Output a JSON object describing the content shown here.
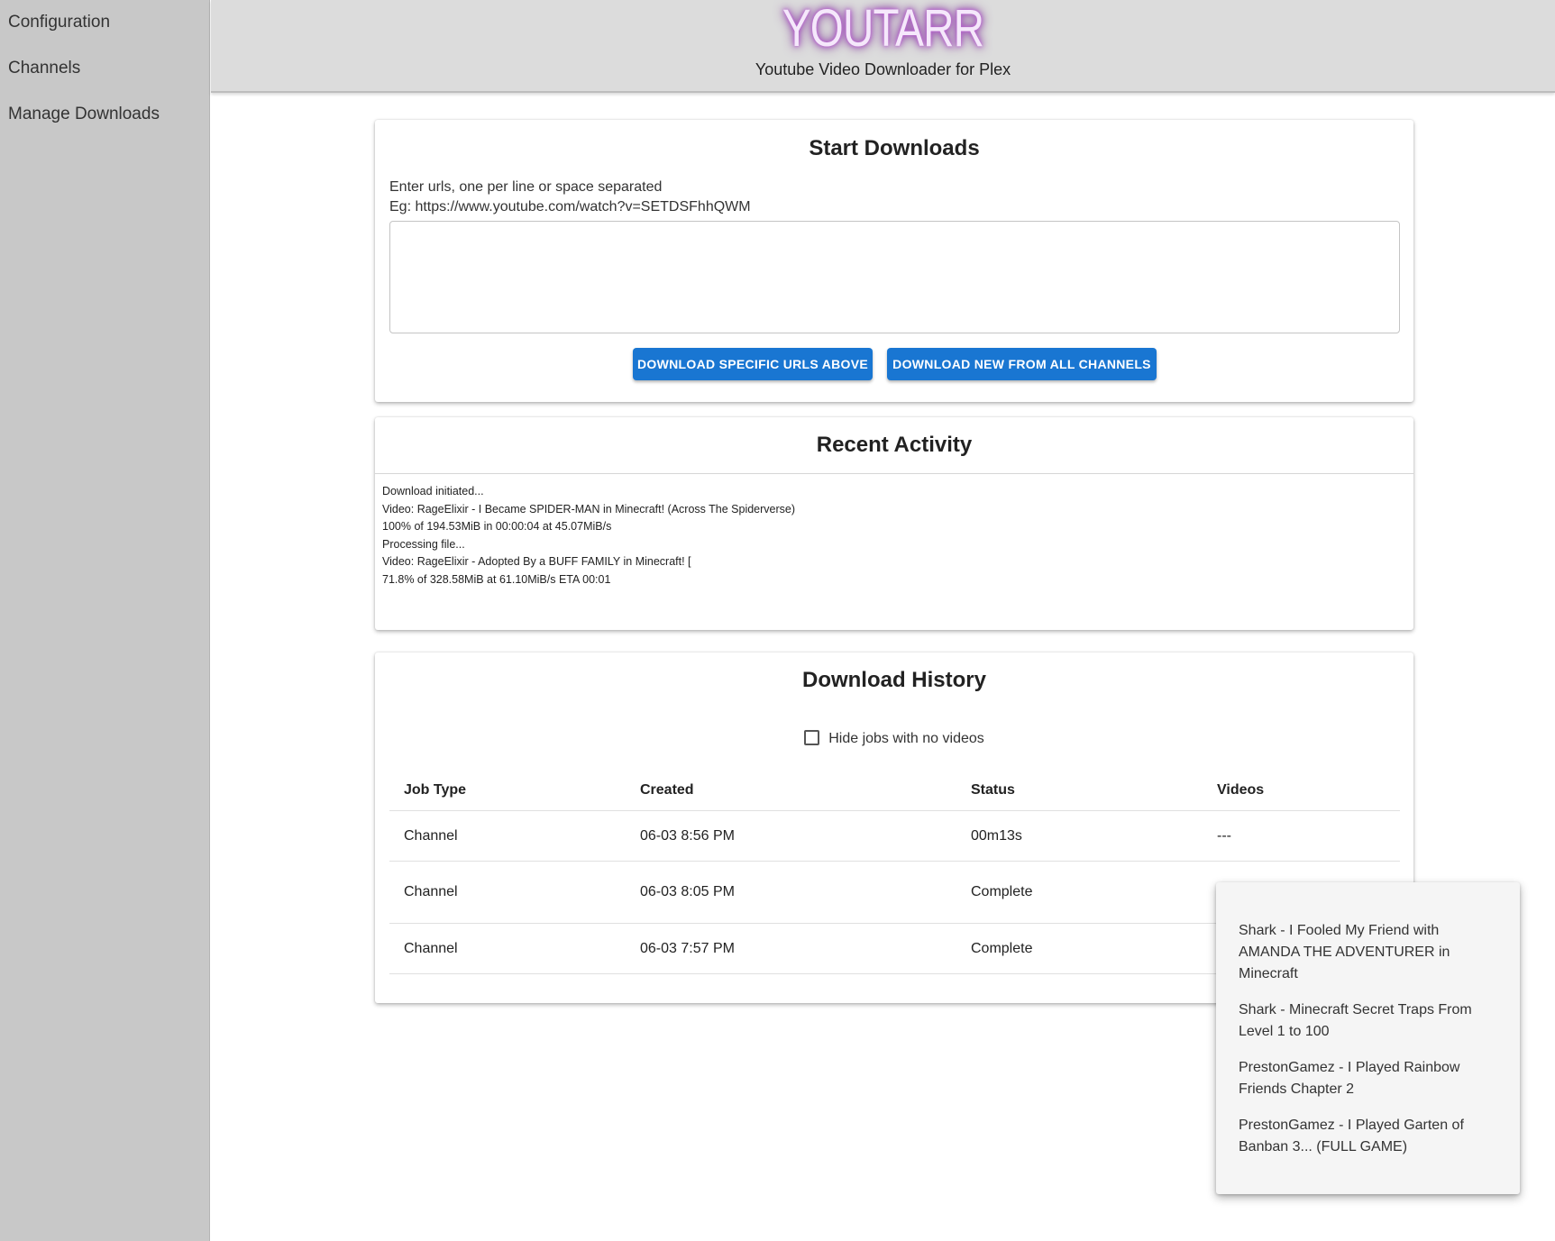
{
  "sidebar": {
    "items": [
      {
        "label": "Configuration"
      },
      {
        "label": "Channels"
      },
      {
        "label": "Manage Downloads"
      }
    ]
  },
  "header": {
    "logo": "YOUTARR",
    "subtitle": "Youtube Video Downloader for Plex"
  },
  "start_downloads": {
    "title": "Start Downloads",
    "hint_line1": "Enter urls, one per line or space separated",
    "hint_line2": "Eg: https://www.youtube.com/watch?v=SETDSFhhQWM",
    "url_value": "",
    "btn_specific": "DOWNLOAD SPECIFIC URLS ABOVE",
    "btn_all": "DOWNLOAD NEW FROM ALL CHANNELS"
  },
  "recent_activity": {
    "title": "Recent Activity",
    "lines": [
      "Download initiated...",
      "Video: RageElixir - I Became SPIDER-MAN in Minecraft! (Across The Spiderverse)",
      "100% of 194.53MiB in 00:00:04 at 45.07MiB/s",
      "Processing file...",
      "Video: RageElixir - Adopted By a BUFF FAMILY in Minecraft! [",
      "71.8% of 328.58MiB at 61.10MiB/s ETA 00:01"
    ]
  },
  "download_history": {
    "title": "Download History",
    "hide_jobs_label": "Hide jobs with no videos",
    "hide_jobs_checked": false,
    "columns": [
      "Job Type",
      "Created",
      "Status",
      "Videos"
    ],
    "rows": [
      {
        "job_type": "Channel",
        "created": "06-03 8:56 PM",
        "status": "00m13s",
        "videos": "---"
      },
      {
        "job_type": "Channel",
        "created": "06-03 8:05 PM",
        "status": "Complete",
        "videos": ""
      },
      {
        "job_type": "Channel",
        "created": "06-03 7:57 PM",
        "status": "Complete",
        "videos": ""
      }
    ]
  },
  "videos_popover": {
    "items": [
      "Shark - I Fooled My Friend with AMANDA THE ADVENTURER in Minecraft",
      "Shark - Minecraft Secret Traps From Level 1 to 100",
      "PrestonGamez - I Played Rainbow Friends Chapter 2",
      "PrestonGamez - I Played Garten of Banban 3... (FULL GAME)"
    ]
  },
  "colors": {
    "primary_button": "#1976d2",
    "sidebar_bg": "#c8c8c8",
    "header_bg": "#dcdcdc",
    "logo_glow": "#9b3fb8"
  }
}
